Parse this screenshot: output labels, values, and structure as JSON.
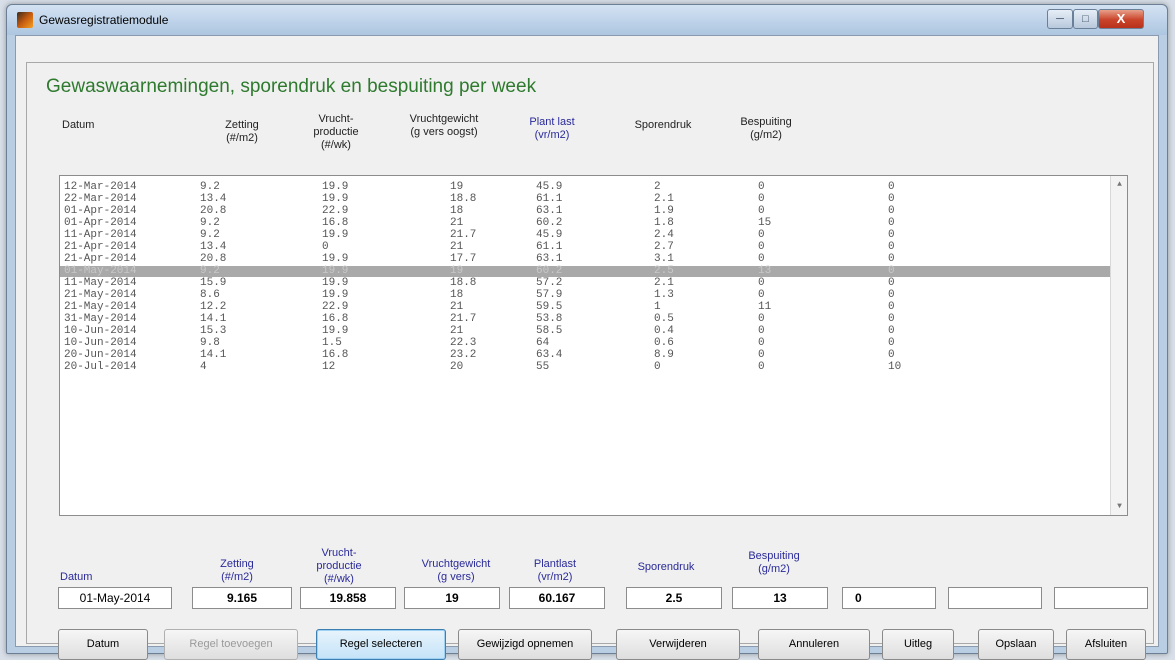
{
  "window": {
    "title": "Gewasregistratiemodule",
    "close_glyph": "X"
  },
  "panel_title": "Gewaswaarnemingen, sporendruk en bespuiting per week",
  "list_headers": {
    "datum": "Datum",
    "zetting": "Zetting",
    "zetting_unit": "(#/m2)",
    "vp1": "Vrucht-",
    "vp2": "productie",
    "vp3": "(#/wk)",
    "vg1": "Vruchtgewicht",
    "vg2": "(g vers oogst)",
    "pl1": "Plant last",
    "pl2": "(vr/m2)",
    "sporendruk": "Sporendruk",
    "bs1": "Bespuiting",
    "bs2": "(g/m2)"
  },
  "rows": [
    [
      "12-Mar-2014",
      "9.2",
      "19.9",
      "19",
      "45.9",
      "2",
      "0",
      "0"
    ],
    [
      "22-Mar-2014",
      "13.4",
      "19.9",
      "18.8",
      "61.1",
      "2.1",
      "0",
      "0"
    ],
    [
      "01-Apr-2014",
      "20.8",
      "22.9",
      "18",
      "63.1",
      "1.9",
      "0",
      "0"
    ],
    [
      "01-Apr-2014",
      "9.2",
      "16.8",
      "21",
      "60.2",
      "1.8",
      "15",
      "0"
    ],
    [
      "11-Apr-2014",
      "9.2",
      "19.9",
      "21.7",
      "45.9",
      "2.4",
      "0",
      "0"
    ],
    [
      "21-Apr-2014",
      "13.4",
      "0",
      "21",
      "61.1",
      "2.7",
      "0",
      "0"
    ],
    [
      "21-Apr-2014",
      "20.8",
      "19.9",
      "17.7",
      "63.1",
      "3.1",
      "0",
      "0"
    ],
    [
      "01-May-2014",
      "9.2",
      "19.9",
      "19",
      "60.2",
      "2.5",
      "13",
      "0"
    ],
    [
      "11-May-2014",
      "15.9",
      "19.9",
      "18.8",
      "57.2",
      "2.1",
      "0",
      "0"
    ],
    [
      "21-May-2014",
      "8.6",
      "19.9",
      "18",
      "57.9",
      "1.3",
      "0",
      "0"
    ],
    [
      "21-May-2014",
      "12.2",
      "22.9",
      "21",
      "59.5",
      "1",
      "11",
      "0"
    ],
    [
      "31-May-2014",
      "14.1",
      "16.8",
      "21.7",
      "53.8",
      "0.5",
      "0",
      "0"
    ],
    [
      "10-Jun-2014",
      "15.3",
      "19.9",
      "21",
      "58.5",
      "0.4",
      "0",
      "0"
    ],
    [
      "10-Jun-2014",
      "9.8",
      "1.5",
      "22.3",
      "64",
      "0.6",
      "0",
      "0"
    ],
    [
      "20-Jun-2014",
      "14.1",
      "16.8",
      "23.2",
      "63.4",
      "8.9",
      "0",
      "0"
    ],
    [
      "20-Jul-2014",
      "4",
      "12",
      "20",
      "55",
      "0",
      "0",
      "10"
    ]
  ],
  "selected_row_index": 7,
  "input_labels": {
    "datum": "Datum",
    "zetting": "Zetting",
    "zetting_unit": "(#/m2)",
    "vp1": "Vrucht-",
    "vp2": "productie",
    "vp3": "(#/wk)",
    "vg1": "Vruchtgewicht",
    "vg2": "(g vers)",
    "pl1": "Plantlast",
    "pl2": "(vr/m2)",
    "sporendruk": "Sporendruk",
    "bs1": "Bespuiting",
    "bs2": "(g/m2)"
  },
  "inputs": {
    "datum": "01-May-2014",
    "zetting": "9.165",
    "vruchtproductie": "19.858",
    "vruchtgewicht": "19",
    "plantlast": "60.167",
    "sporendruk": "2.5",
    "bespuiting": "13",
    "extra1": "0",
    "extra2": "",
    "extra3": ""
  },
  "buttons": {
    "datum": "Datum",
    "regel_toevoegen": "Regel toevoegen",
    "regel_selecteren": "Regel selecteren",
    "gewijzigd_opnemen": "Gewijzigd opnemen",
    "verwijderen": "Verwijderen",
    "annuleren": "Annuleren",
    "uitleg": "Uitleg",
    "opslaan": "Opslaan",
    "afsluiten": "Afsluiten"
  }
}
